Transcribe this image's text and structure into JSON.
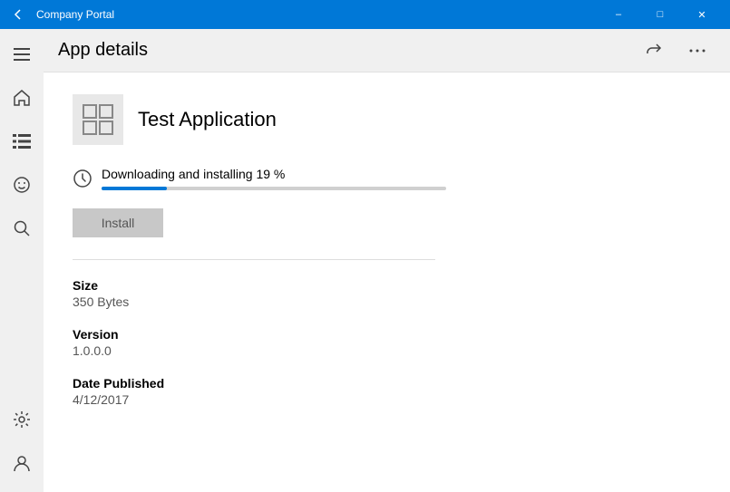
{
  "titleBar": {
    "title": "Company Portal",
    "backLabel": "←",
    "minimizeLabel": "–",
    "restoreLabel": "□",
    "closeLabel": "✕"
  },
  "header": {
    "title": "App details",
    "shareLabel": "⎙",
    "moreLabel": "···"
  },
  "sidebar": {
    "homeIcon": "⌂",
    "listIcon": "☰",
    "smileyIcon": "☺",
    "searchIcon": "🔍",
    "settingsIcon": "⚙",
    "userIcon": "👤"
  },
  "app": {
    "name": "Test Application",
    "downloadStatus": "Downloading and installing  19 %",
    "progressPercent": 19,
    "progressWidth": "19%",
    "installButton": "Install",
    "size": {
      "label": "Size",
      "value": "350 Bytes"
    },
    "version": {
      "label": "Version",
      "value": "1.0.0.0"
    },
    "datePublished": {
      "label": "Date Published",
      "value": "4/12/2017"
    }
  }
}
